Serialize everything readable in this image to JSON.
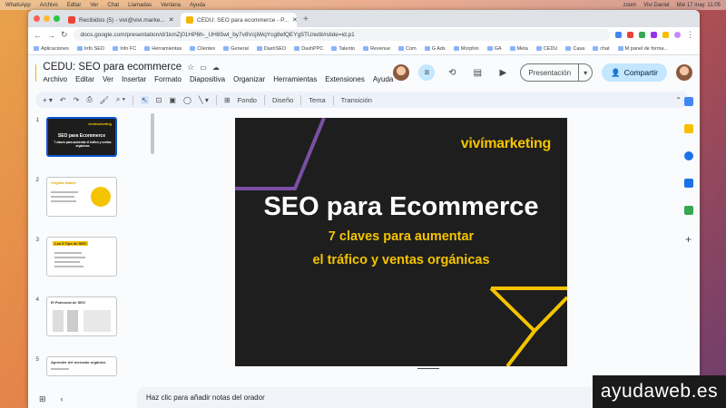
{
  "menubar": {
    "items": [
      "WhatsApp",
      "Archivo",
      "Editar",
      "Ver",
      "Chat",
      "Llamadas",
      "Ventana",
      "Ayuda"
    ],
    "right": [
      "zoom",
      "Vivi Daniel",
      "Mié 17 may. 11:05"
    ]
  },
  "tabs": [
    {
      "label": "Recibidos (5) - vivi@vivi.marke...",
      "active": false,
      "fav_color": "#ea4335"
    },
    {
      "label": "CEDU: SEO para ecommerce - P...",
      "active": true,
      "fav_color": "#f4b400"
    }
  ],
  "addressbar": {
    "url": "docs.google.com/presentation/d/1kmZj01HP6h-_UH85wt_by7v8VcjiWqYcg8efQEYg5TU/edit#slide=id.p1"
  },
  "bookmarks": [
    "Aplicaciones",
    "Info SEO",
    "Info FC",
    "Herramientas",
    "Clientes",
    "General",
    "DashSEO",
    "DashPPC",
    "Talento",
    "Revenue",
    "Com",
    "G Ads",
    "Morphin",
    "GA",
    "Meta",
    "CEDU",
    "Casa",
    "chat",
    "M panel de forma..."
  ],
  "app": {
    "doc_title": "CEDU: SEO para ecommerce",
    "menu": [
      "Archivo",
      "Editar",
      "Ver",
      "Insertar",
      "Formato",
      "Diapositiva",
      "Organizar",
      "Herramientas",
      "Extensiones",
      "Ayuda"
    ],
    "present_label": "Presentación",
    "share_label": "Compartir"
  },
  "toolbar": {
    "fondo": "Fondo",
    "diseno": "Diseño",
    "tema": "Tema",
    "transicion": "Transición"
  },
  "filmstrip": {
    "numbers": [
      "1",
      "2",
      "3",
      "4",
      "5"
    ],
    "thumb1_brand": "vivímarketing",
    "thumb1_title": "SEO para Ecommerce",
    "thumb1_sub": "7 claves para aumentar el tráfico y ventas orgánicas",
    "thumb2_title": "Virginia Daniel",
    "thumb3_title": "Los 5 Tips de SEO",
    "thumb4_title": "El Potencial de SEO",
    "thumb5_title": "Aprender del mercado orgánico"
  },
  "slide": {
    "brand_bold": "vivímarketing",
    "title": "SEO para Ecommerce",
    "subtitle_line1": "7 claves para aumentar",
    "subtitle_line2": "el tráfico y ventas orgánicas",
    "colors": {
      "background": "#1e1e1e",
      "accent_yellow": "#f5c400",
      "accent_purple": "#7b4fa3"
    }
  },
  "notes": {
    "placeholder": "Haz clic para añadir notas del orador"
  },
  "watermark": "ayudaweb.es"
}
